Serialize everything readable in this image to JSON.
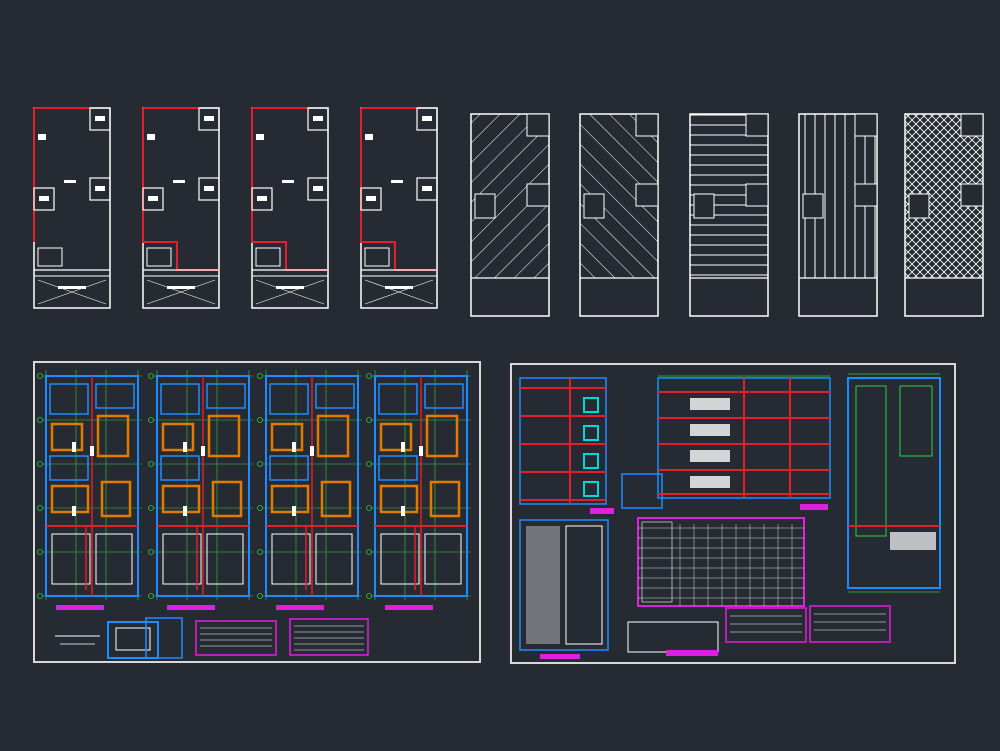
{
  "view": {
    "background": "#262b33",
    "colors": {
      "wall": "#ffffff",
      "boundary": "#e0202a",
      "structure": "#1e8cff",
      "axis": "#2ecc40",
      "highlight": "#e27a00",
      "annotation": "#e020e0",
      "frame": "#d8d8d8"
    }
  },
  "top_row": {
    "floor_plans": [
      {
        "name": "plan-1",
        "style": "boundary-lower"
      },
      {
        "name": "plan-2",
        "style": "boundary-step"
      },
      {
        "name": "plan-3",
        "style": "boundary-step"
      },
      {
        "name": "plan-4",
        "style": "boundary-step"
      }
    ],
    "slab_patterns": [
      {
        "name": "slab-diagonal-1",
        "pattern": "diagonal"
      },
      {
        "name": "slab-diagonal-2",
        "pattern": "diagonal-reverse"
      },
      {
        "name": "slab-horizontal",
        "pattern": "horizontal"
      },
      {
        "name": "slab-vertical",
        "pattern": "vertical"
      },
      {
        "name": "slab-grid",
        "pattern": "crosshatch"
      }
    ]
  },
  "sheets": [
    {
      "name": "sheet-floor-plans",
      "content": "four-structural-plans"
    },
    {
      "name": "sheet-sections",
      "content": "sections-and-schedules"
    }
  ]
}
